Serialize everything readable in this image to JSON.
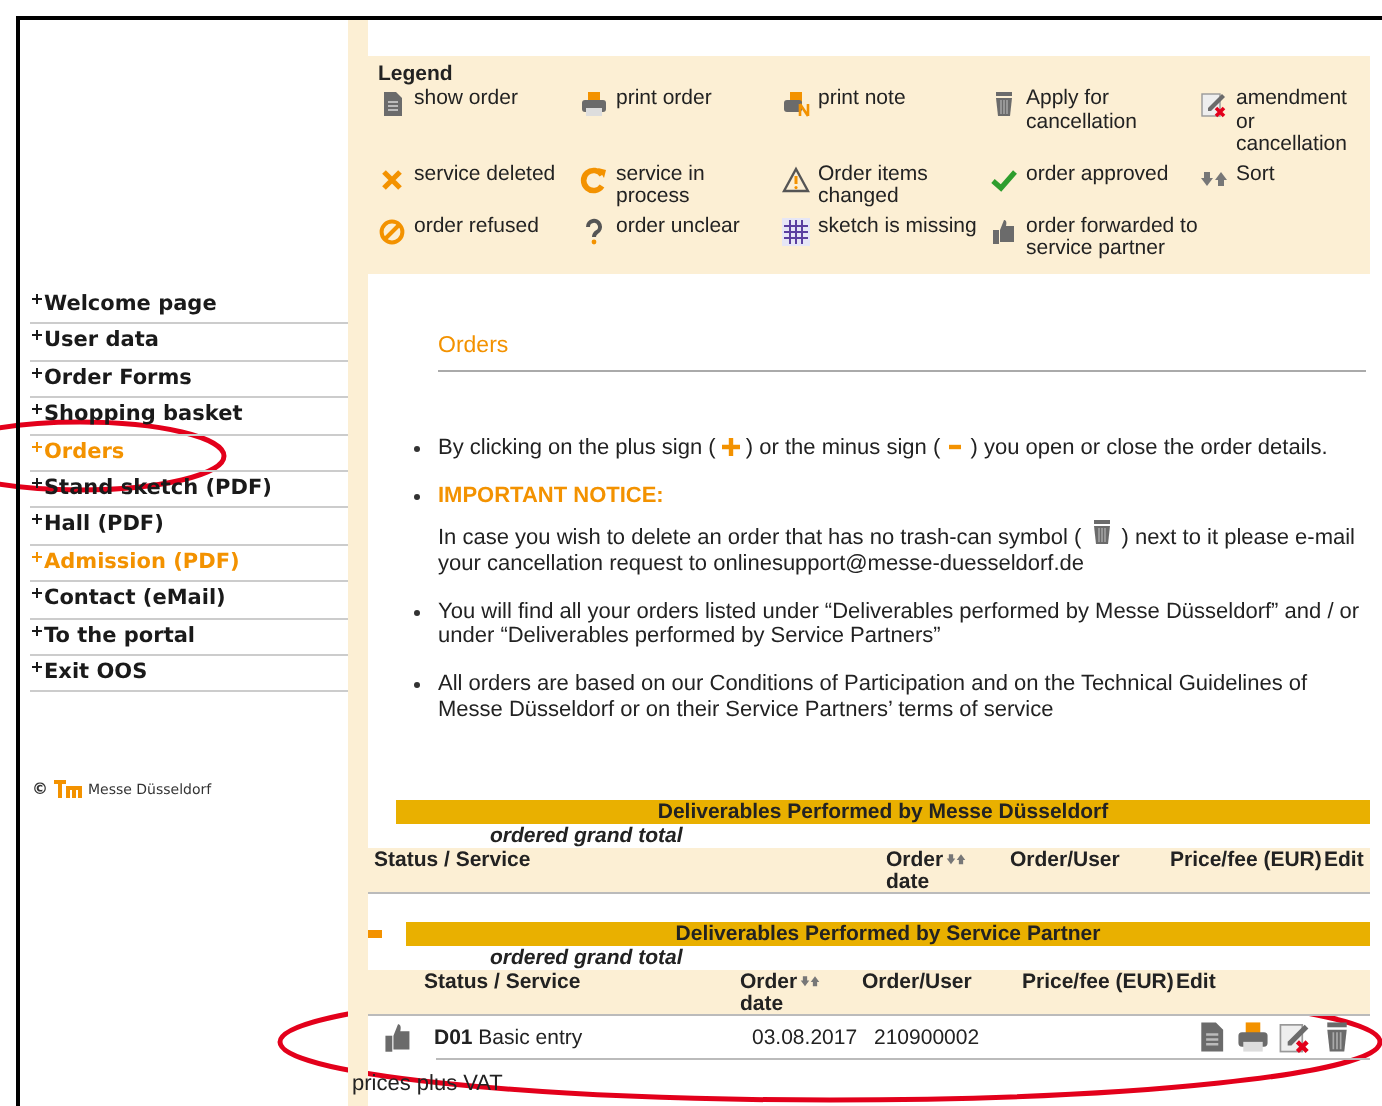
{
  "sidebar": {
    "nav_items": [
      {
        "label": "Welcome page",
        "highlighted": false
      },
      {
        "label": "User data",
        "highlighted": false
      },
      {
        "label": "Order Forms",
        "highlighted": false
      },
      {
        "label": "Shopping basket",
        "highlighted": false
      },
      {
        "label": "Orders",
        "highlighted": true
      },
      {
        "label": "Stand sketch (PDF)",
        "highlighted": false
      },
      {
        "label": "Hall (PDF)",
        "highlighted": false
      },
      {
        "label": "Admission (PDF)",
        "highlighted": true
      },
      {
        "label": "Contact (eMail)",
        "highlighted": false
      },
      {
        "label": "To the portal",
        "highlighted": false
      },
      {
        "label": "Exit OOS",
        "highlighted": false
      }
    ],
    "copyright": "©",
    "logo_text": "Messe Düsseldorf"
  },
  "legend": {
    "title": "Legend",
    "items": [
      {
        "kind": "show",
        "label": "show order"
      },
      {
        "kind": "print",
        "label": "print order"
      },
      {
        "kind": "print-note",
        "label": "print note"
      },
      {
        "kind": "trash",
        "label": "Apply for cancellation"
      },
      {
        "kind": "amend",
        "label": "amendment or cancellation"
      },
      {
        "kind": "deleted",
        "label": "service deleted"
      },
      {
        "kind": "in-process",
        "label": "service in process"
      },
      {
        "kind": "changed",
        "label": "Order items changed"
      },
      {
        "kind": "approved",
        "label": "order approved"
      },
      {
        "kind": "sort",
        "label": "Sort"
      },
      {
        "kind": "refused",
        "label": "order refused"
      },
      {
        "kind": "unclear",
        "label": "order unclear"
      },
      {
        "kind": "sketch-missing",
        "label": "sketch is missing"
      },
      {
        "kind": "forwarded",
        "label": "order forwarded to service partner"
      }
    ]
  },
  "orders": {
    "heading": "Orders",
    "notes": [
      {
        "kind": "signs",
        "before": "By clicking on the plus sign (",
        "middle": ") or the minus sign (",
        "after": ") you open or close the order details."
      },
      {
        "kind": "notice",
        "title": "IMPORTANT NOTICE:",
        "before": "In case you wish to delete an order that has no trash-can symbol (",
        "after": ") next to it please e-mail your cancellation request to onlinesupport@messe-duesseldorf.de"
      },
      {
        "kind": "text",
        "text": "You will find all your orders listed under “Deliverables performed by Messe Düsseldorf” and / or under “Deliverables performed by Service Partners”"
      },
      {
        "kind": "text",
        "text": "All orders are based on our Conditions of Participation and on the Technical Guidelines of Messe Düsseldorf or on their Service Partners’ terms of service"
      }
    ]
  },
  "sections": [
    {
      "title": "Deliverables Performed by Messe Düsseldorf",
      "expanded": false,
      "total_label": "ordered grand total",
      "columns": [
        {
          "label": "Status / Service",
          "sortable": false
        },
        {
          "label": "Order date",
          "sortable": true
        },
        {
          "label": "Order/User",
          "sortable": false
        },
        {
          "label": "Price/fee (EUR)",
          "sortable": false
        },
        {
          "label": "Edit",
          "sortable": false
        }
      ]
    },
    {
      "title": "Deliverables Performed by Service Partner",
      "expanded": true,
      "total_label": "ordered grand total",
      "columns": [
        {
          "label": "Status / Service",
          "sortable": false
        },
        {
          "label": "Order date",
          "sortable": true
        },
        {
          "label": "Order/User",
          "sortable": false
        },
        {
          "label": "Price/fee (EUR)",
          "sortable": false
        },
        {
          "label": "Edit",
          "sortable": false
        }
      ],
      "rows": [
        {
          "kind": "forwarded",
          "code": "D01",
          "service": "Basic entry",
          "date": "03.08.2017",
          "order_user": "210900002",
          "actions": [
            {
              "kind": "show"
            },
            {
              "kind": "print"
            },
            {
              "kind": "amend"
            },
            {
              "kind": "trash"
            }
          ]
        }
      ]
    }
  ],
  "footer_note": "prices plus VAT",
  "annotations": [
    {
      "kind": "ellipse",
      "color": "#e3001b"
    },
    {
      "kind": "ellipse",
      "color": "#e3001b"
    }
  ]
}
